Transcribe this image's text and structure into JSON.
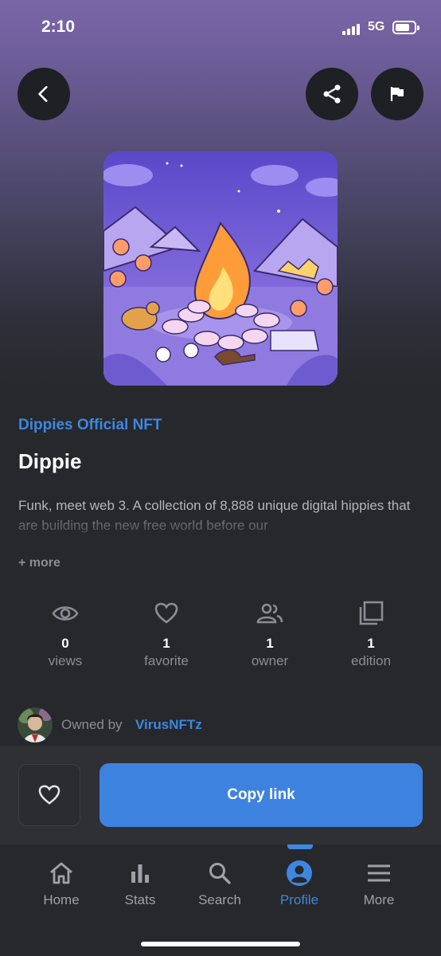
{
  "status_bar": {
    "time": "2:10",
    "network": "5G"
  },
  "nft": {
    "collection": "Dippies Official NFT",
    "title": "Dippie",
    "description": "Funk, meet web 3. A collection of 8,888 unique digital hippies that are building the new free world before our",
    "more_label": "+ more"
  },
  "stats": [
    {
      "icon": "eye-icon",
      "value": "0",
      "label": "views"
    },
    {
      "icon": "heart-icon",
      "value": "1",
      "label": "favorite"
    },
    {
      "icon": "people-icon",
      "value": "1",
      "label": "owner"
    },
    {
      "icon": "copies-icon",
      "value": "1",
      "label": "edition"
    }
  ],
  "owner": {
    "prefix": "Owned by",
    "name": "VirusNFTz"
  },
  "actions": {
    "copy_link_label": "Copy link"
  },
  "tabs": [
    {
      "label": "Home",
      "icon": "home-icon",
      "active": false
    },
    {
      "label": "Stats",
      "icon": "bar-chart-icon",
      "active": false
    },
    {
      "label": "Search",
      "icon": "search-icon",
      "active": false
    },
    {
      "label": "Profile",
      "icon": "profile-icon",
      "active": true
    },
    {
      "label": "More",
      "icon": "menu-icon",
      "active": false
    }
  ],
  "colors": {
    "accent": "#3e87e0",
    "button": "#3e82e0",
    "background": "#26282c"
  }
}
